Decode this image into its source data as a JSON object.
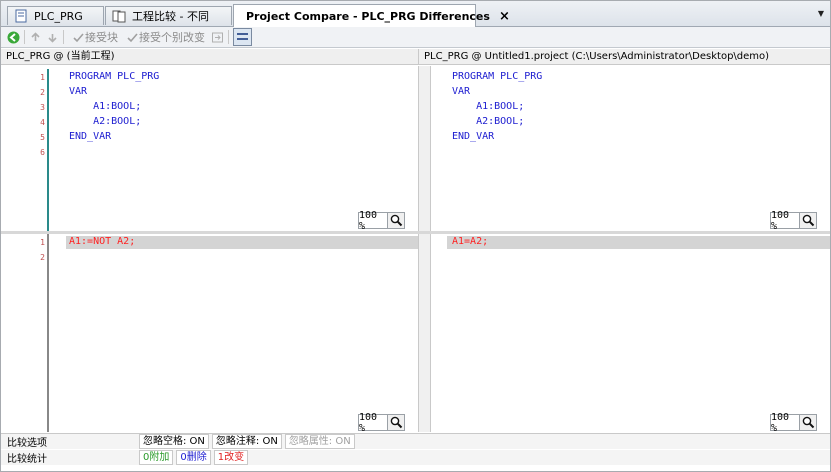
{
  "tabs": [
    {
      "label": "PLC_PRG",
      "active": false
    },
    {
      "label": "工程比较 - 不同",
      "active": false
    },
    {
      "label": "Project Compare - PLC_PRG Differences",
      "active": true
    }
  ],
  "tab_close": "×",
  "tab_overflow": "▼",
  "toolbar": {
    "accept_block": "接受块",
    "accept_change": "接受个别改变"
  },
  "left_pane": {
    "header": "PLC_PRG @ (当前工程)",
    "top_lines": [
      {
        "num": "1",
        "text": "PROGRAM PLC_PRG"
      },
      {
        "num": "2",
        "text": "VAR"
      },
      {
        "num": "3",
        "text": "    A1:BOOL;"
      },
      {
        "num": "4",
        "text": "    A2:BOOL;"
      },
      {
        "num": "5",
        "text": "END_VAR"
      },
      {
        "num": "6",
        "text": ""
      }
    ],
    "bottom_lines": [
      {
        "num": "1",
        "text": "A1:=NOT A2;"
      },
      {
        "num": "2",
        "text": ""
      }
    ]
  },
  "right_pane": {
    "header": "PLC_PRG @ Untitled1.project (C:\\Users\\Administrator\\Desktop\\demo)",
    "top_lines": [
      {
        "text": "PROGRAM PLC_PRG"
      },
      {
        "text": "VAR"
      },
      {
        "text": "    A1:BOOL;"
      },
      {
        "text": "    A2:BOOL;"
      },
      {
        "text": "END_VAR"
      }
    ],
    "bottom_lines": [
      {
        "text": "A1=A2;"
      }
    ]
  },
  "zoom_label": "100 %",
  "status": {
    "options_label": "比较选项",
    "ignore_spaces": "忽略空格: ON",
    "ignore_comments": "忽略注释: ON",
    "ignore_props": "忽略属性: ON",
    "stats_label": "比较统计",
    "added": "0附加",
    "deleted": "0删除",
    "changed": "1改变"
  },
  "colors": {
    "keyword": "#1c1cd0",
    "diff_text": "#ff2020",
    "diff_bg": "#d4d4d4",
    "gutter_num": "#c05050",
    "gutter_bar": "#2a8a8a",
    "added": "#2a9a2a",
    "deleted": "#1c1cd0",
    "changed": "#e02020"
  }
}
